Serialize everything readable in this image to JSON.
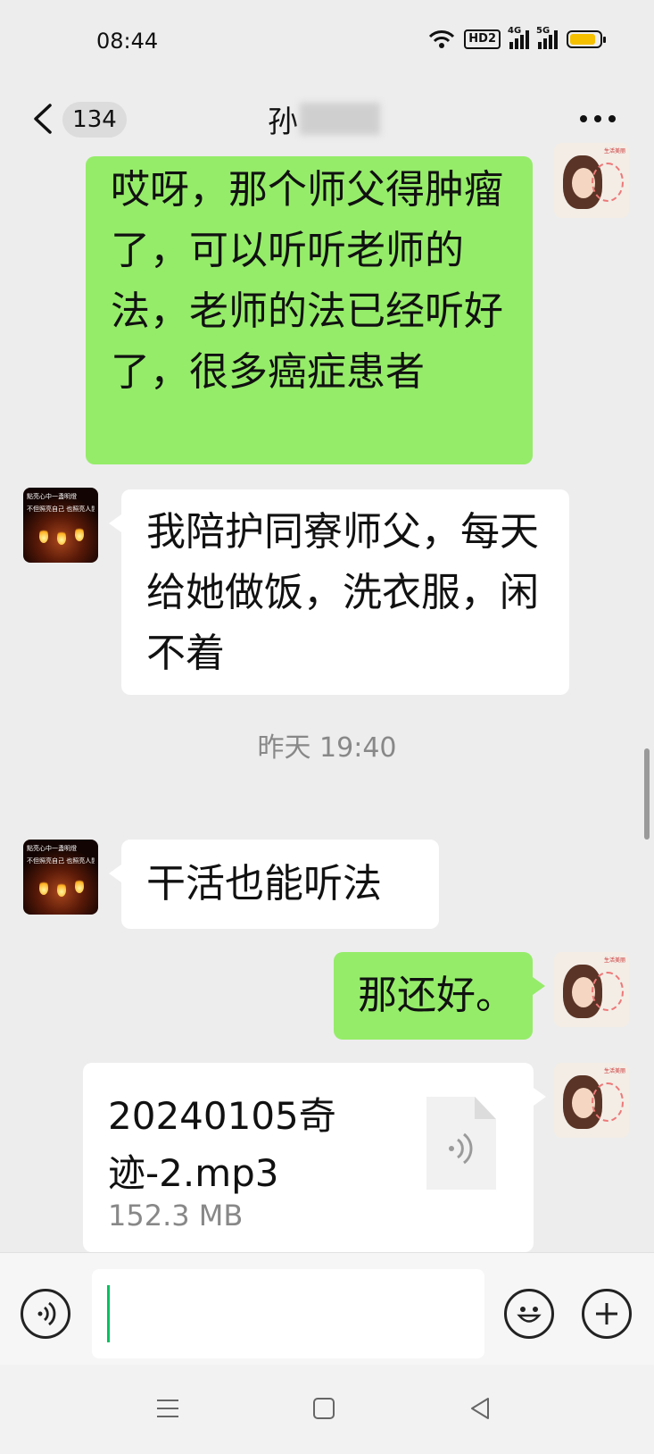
{
  "status_bar": {
    "time": "08:44",
    "hd_label": "HD2",
    "signal_1_label": "4G",
    "signal_2_label": "5G",
    "battery_color": "#f5c000"
  },
  "header": {
    "unread_count": "134",
    "contact_name": "孙"
  },
  "messages": [
    {
      "side": "right",
      "text": "哎呀，那个师父得肿瘤了，可以听听老师的法，老师的法已经听好了，很多癌症患者"
    },
    {
      "side": "left",
      "text": "我陪护同寮师父，每天给她做饭，洗衣服，闲不着"
    },
    {
      "side": "left",
      "text": "干活也能听法"
    },
    {
      "side": "right",
      "text": "那还好。"
    }
  ],
  "timestamp": "昨天 19:40",
  "file_message": {
    "file_name": "20240105奇迹-2.mp3",
    "file_size": "152.3 MB"
  },
  "avatars": {
    "other_caption_1": "點亮心中一盞明燈",
    "other_caption_2": "不但照亮自己 也照亮人間",
    "me_caption": "生活美丽"
  },
  "colors": {
    "my_bubble": "#95ec69",
    "other_bubble": "#ffffff",
    "background": "#ededed",
    "cursor": "#07c160"
  },
  "icons": [
    "back-icon",
    "more-icon",
    "voice-icon",
    "emoji-icon",
    "plus-icon",
    "audio-file-icon",
    "menu-nav-icon",
    "home-nav-icon",
    "back-nav-icon",
    "wifi-icon",
    "battery-icon"
  ]
}
